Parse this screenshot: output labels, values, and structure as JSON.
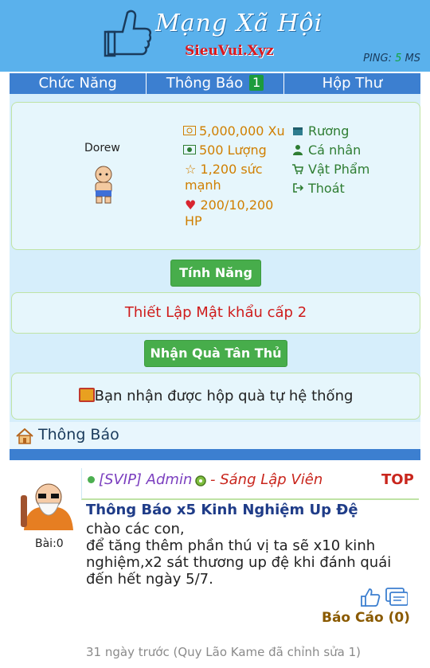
{
  "header": {
    "title": "Mạng Xã Hội",
    "subtitle": "SieuVui.Xyz",
    "ping_label": "PING:",
    "ping_value": "5",
    "ping_unit": "MS"
  },
  "nav": {
    "items": [
      {
        "label": "Chức Năng"
      },
      {
        "label": "Thông Báo",
        "badge": "1"
      },
      {
        "label": "Hộp Thư"
      }
    ]
  },
  "profile": {
    "username": "Dorew",
    "xu": "5,000,000 Xu",
    "luong": "500 Lượng",
    "power_line1": "1,200 sức",
    "power_line2": "mạnh",
    "hp_line1": "200/10,200",
    "hp_line2": "HP",
    "links": [
      "Rương",
      "Cá nhân",
      "Vật Phẩm",
      "Thoát"
    ]
  },
  "buttons": {
    "features": "Tính Năng",
    "gift": "Nhận Quà Tân Thủ"
  },
  "security_link": "Thiết Lập Mật khẩu cấp 2",
  "gift_notice": "Bạn nhận được hộp quà tự hệ thống",
  "section": {
    "title": "Thông Báo"
  },
  "post": {
    "author": "[SVIP] Admin",
    "role": "- Sáng Lập Viên",
    "top_label": "TOP",
    "post_count": "Bài:0",
    "title": "Thông Báo x5 Kinh Nghiệm Up Đệ",
    "body": [
      "chào các con,",
      "để tăng thêm phần thú vị ta sẽ x10 kinh",
      "nghiệm,x2 sát thương up đệ khi đánh quái",
      "đến hết ngày 5/7."
    ],
    "report": "Báo Cáo (0)",
    "edited": "31 ngày trước (Quy Lão Kame đã chỉnh sửa 1)"
  },
  "colors": {
    "header_bg": "#5ab1ec",
    "nav_bg": "#3c7fd0",
    "panel_bg": "#e6f6fc",
    "green_button": "#47ad4b",
    "red_text": "#cf1c1c"
  }
}
